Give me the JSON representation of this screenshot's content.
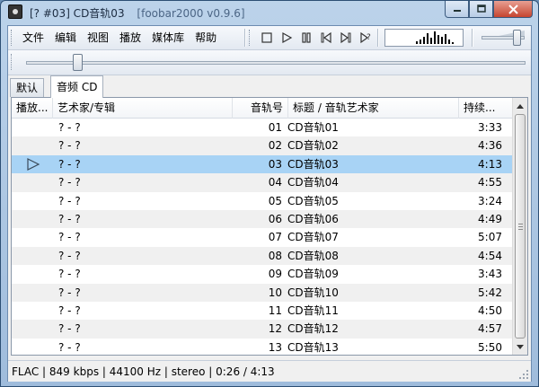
{
  "window": {
    "title_segments": [
      "[? #03] CD音轨03",
      "[foobar2000 v0.9.6]"
    ]
  },
  "menu": [
    "文件",
    "编辑",
    "视图",
    "播放",
    "媒体库",
    "帮助"
  ],
  "transport": {
    "buttons": [
      "stop-icon",
      "play-icon",
      "pause-icon",
      "previous-icon",
      "next-icon",
      "random-icon"
    ]
  },
  "tabs": [
    {
      "label": "默认",
      "active": false
    },
    {
      "label": "音频 CD",
      "active": true
    }
  ],
  "playlist": {
    "columns": [
      "播放...",
      "艺术家/专辑",
      "音轨号",
      "标题 / 音轨艺术家",
      "持续..."
    ],
    "rows": [
      {
        "playing": "",
        "artist": "? - ?",
        "track": "01",
        "title": "CD音轨01",
        "duration": "3:33"
      },
      {
        "playing": "",
        "artist": "? - ?",
        "track": "02",
        "title": "CD音轨02",
        "duration": "4:36"
      },
      {
        "playing": "▷",
        "artist": "? - ?",
        "track": "03",
        "title": "CD音轨03",
        "duration": "4:13"
      },
      {
        "playing": "",
        "artist": "? - ?",
        "track": "04",
        "title": "CD音轨04",
        "duration": "4:55"
      },
      {
        "playing": "",
        "artist": "? - ?",
        "track": "05",
        "title": "CD音轨05",
        "duration": "3:24"
      },
      {
        "playing": "",
        "artist": "? - ?",
        "track": "06",
        "title": "CD音轨06",
        "duration": "4:49"
      },
      {
        "playing": "",
        "artist": "? - ?",
        "track": "07",
        "title": "CD音轨07",
        "duration": "5:07"
      },
      {
        "playing": "",
        "artist": "? - ?",
        "track": "08",
        "title": "CD音轨08",
        "duration": "4:54"
      },
      {
        "playing": "",
        "artist": "? - ?",
        "track": "09",
        "title": "CD音轨09",
        "duration": "3:43"
      },
      {
        "playing": "",
        "artist": "? - ?",
        "track": "10",
        "title": "CD音轨10",
        "duration": "5:42"
      },
      {
        "playing": "",
        "artist": "? - ?",
        "track": "11",
        "title": "CD音轨11",
        "duration": "4:50"
      },
      {
        "playing": "",
        "artist": "? - ?",
        "track": "12",
        "title": "CD音轨12",
        "duration": "4:57"
      },
      {
        "playing": "",
        "artist": "? - ?",
        "track": "13",
        "title": "CD音轨13",
        "duration": "5:50"
      }
    ],
    "selected_index": 2
  },
  "seek": {
    "position_fraction": 0.1
  },
  "volume": {
    "level_fraction": 0.85
  },
  "status": {
    "text": "FLAC | 849 kbps | 44100 Hz | stereo | 0:26 / 4:13"
  },
  "colors": {
    "selected_row": "#a8d3f5",
    "alt_row": "#f0f0f0",
    "title_bar": "#bcd3ea",
    "close_button": "#c6452f"
  }
}
